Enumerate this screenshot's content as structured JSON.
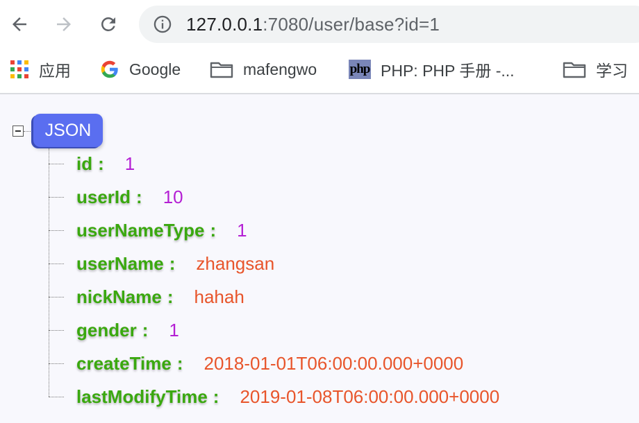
{
  "toolbar": {
    "url_host": "127.0.0.1",
    "url_rest": ":7080/user/base?id=1",
    "back_icon": "arrow-left",
    "forward_icon": "arrow-right",
    "reload_icon": "reload",
    "info_icon": "info-circle"
  },
  "bookmarks": [
    {
      "label": "应用",
      "icon": "apps-grid"
    },
    {
      "label": "Google",
      "icon": "google-g"
    },
    {
      "label": "mafengwo",
      "icon": "folder"
    },
    {
      "label": "PHP: PHP 手册 -...",
      "icon": "php",
      "badge": "php"
    },
    {
      "label": "学习",
      "icon": "folder"
    }
  ],
  "json_viewer": {
    "root_label": "JSON",
    "fields": [
      {
        "key": "id",
        "value": "1",
        "type": "number"
      },
      {
        "key": "userId",
        "value": "10",
        "type": "number"
      },
      {
        "key": "userNameType",
        "value": "1",
        "type": "number"
      },
      {
        "key": "userName",
        "value": "zhangsan",
        "type": "string"
      },
      {
        "key": "nickName",
        "value": "hahah",
        "type": "string"
      },
      {
        "key": "gender",
        "value": "1",
        "type": "number"
      },
      {
        "key": "createTime",
        "value": "2018-01-01T06:00:00.000+0000",
        "type": "string"
      },
      {
        "key": "lastModifyTime",
        "value": "2019-01-08T06:00:00.000+0000",
        "type": "string"
      }
    ],
    "colors": {
      "key": "#3aa80f",
      "number": "#b41fd4",
      "string": "#e8552b",
      "root_badge": "#5a6ef0"
    }
  }
}
